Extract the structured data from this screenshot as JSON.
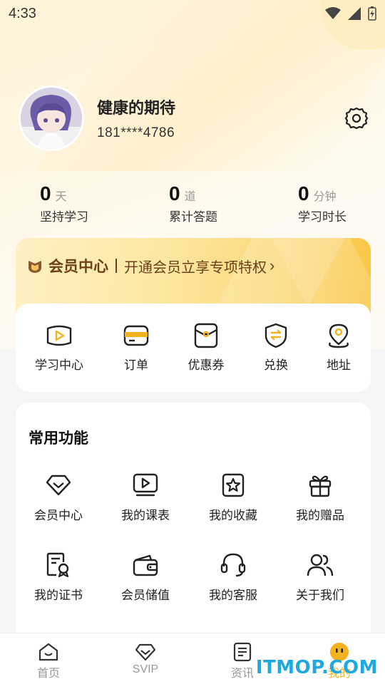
{
  "status_bar": {
    "time": "4:33"
  },
  "profile": {
    "nickname": "健康的期待",
    "phone": "181****4786"
  },
  "stats": [
    {
      "value": "0",
      "unit": "天",
      "label": "坚持学习"
    },
    {
      "value": "0",
      "unit": "道",
      "label": "累计答题"
    },
    {
      "value": "0",
      "unit": "分钟",
      "label": "学习时长"
    }
  ],
  "vip": {
    "title": "会员中心",
    "subtitle": "开通会员立享专项特权",
    "chevron": "›"
  },
  "quick_menu": [
    {
      "label": "学习中心",
      "icon": "play-book-icon"
    },
    {
      "label": "订单",
      "icon": "card-icon"
    },
    {
      "label": "优惠券",
      "icon": "coupon-icon"
    },
    {
      "label": "兑换",
      "icon": "exchange-shield-icon"
    },
    {
      "label": "地址",
      "icon": "location-icon"
    }
  ],
  "functions": {
    "title": "常用功能",
    "items": [
      {
        "label": "会员中心",
        "icon": "diamond-icon"
      },
      {
        "label": "我的课表",
        "icon": "video-lesson-icon"
      },
      {
        "label": "我的收藏",
        "icon": "star-bookmark-icon"
      },
      {
        "label": "我的赠品",
        "icon": "gift-icon"
      },
      {
        "label": "我的证书",
        "icon": "certificate-icon"
      },
      {
        "label": "会员储值",
        "icon": "wallet-icon"
      },
      {
        "label": "我的客服",
        "icon": "headset-icon"
      },
      {
        "label": "关于我们",
        "icon": "users-icon"
      }
    ]
  },
  "tabbar": [
    {
      "label": "首页",
      "icon": "home-icon"
    },
    {
      "label": "SVIP",
      "icon": "diamond-icon"
    },
    {
      "label": "资讯",
      "icon": "news-icon"
    },
    {
      "label": "我的",
      "icon": "face-icon",
      "active": true
    }
  ],
  "watermark": "ITMOP.COM",
  "colors": {
    "accent": "#f3b320",
    "vip_text": "#6b3f18"
  }
}
